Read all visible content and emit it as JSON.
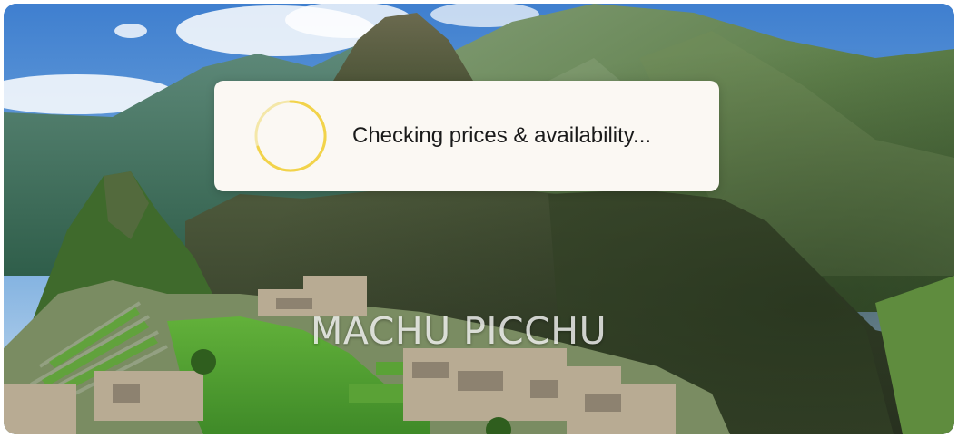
{
  "destination": {
    "title": "MACHU PICCHU"
  },
  "loading": {
    "message": "Checking prices & availability...",
    "spinner_icon": "loading-spinner-icon",
    "spinner_color": "#f2d34a"
  },
  "colors": {
    "panel_background": "#fbf8f3",
    "text": "#1a1a1a"
  }
}
